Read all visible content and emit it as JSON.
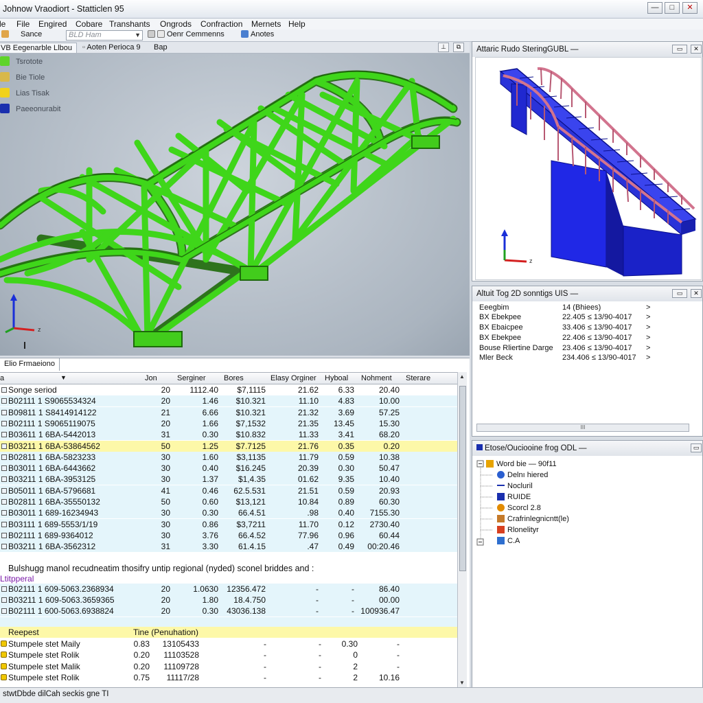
{
  "window": {
    "title": "Johnow Vraodiort - Statticlen 95"
  },
  "menu": [
    "File",
    "Engired",
    "Cobare",
    "Transhants",
    "Ongrods",
    "Confraction",
    "Mernets",
    "Help"
  ],
  "menu_prefix": "le",
  "toolbar": {
    "item1": "Sance",
    "dropdown_value": "BLD Ham",
    "item2": "Oenr Cemmenns",
    "item3": "Anotes"
  },
  "doc_tabs": [
    "VB Eegenarble Llbou",
    "Aoten Perioca 9",
    "Bap"
  ],
  "legend": [
    {
      "label": "Tsrotote",
      "color": "#5fd42a"
    },
    {
      "label": "Bie Tiole",
      "color": "#d8b84a"
    },
    {
      "label": "Lias Tisak",
      "color": "#f1d21a"
    },
    {
      "label": "Paeeonurabit",
      "color": "#1a2fae"
    }
  ],
  "panel_view": {
    "title": "Attaric Rudo SteringGUBL —"
  },
  "panel_props": {
    "title": "Altuit Tog 2D sonntigs UIS —",
    "rows": [
      {
        "key": "Eeegbim",
        "value": "14 (Bhiees)"
      },
      {
        "key": "BX Ebekpee",
        "value": "22.405 ≤ 13/90-4017"
      },
      {
        "key": "BX Ebaicpee",
        "value": "33.406 ≤ 13/90-4017"
      },
      {
        "key": "BX Ebekpee",
        "value": "22.406 ≤ 13/90-4017"
      },
      {
        "key": "Bouse Rliertine Darge",
        "value": "23.406 ≤ 13/90-4017"
      },
      {
        "key": "Mler Beck",
        "value": "234.406 ≤ 13/90-4017"
      }
    ],
    "arrow": ">",
    "hscroll": "III"
  },
  "panel_tree": {
    "title": "Etose/Ouciooine frog ODL —",
    "items": [
      {
        "label": "Word bie — 90f11",
        "indent": 0,
        "icon": "#e7a300"
      },
      {
        "label": "Delnı hiered",
        "indent": 1,
        "icon": "#2b5fd0"
      },
      {
        "label": "Nocluril",
        "indent": 1,
        "icon": "#1a2fae"
      },
      {
        "label": "RUIDE",
        "indent": 1,
        "icon": "#1a2fae"
      },
      {
        "label": "Scorcl 2.8",
        "indent": 1,
        "icon": "#e28b00"
      },
      {
        "label": "Crafrinlegnicntt(le)",
        "indent": 1,
        "icon": "#c57a2a"
      },
      {
        "label": "Rlonelityr",
        "indent": 1,
        "icon": "#d84020"
      },
      {
        "label": "C.A",
        "indent": 1,
        "icon": "#2e6fcf"
      }
    ]
  },
  "bottom": {
    "tab": "Elio Frmaeiono",
    "headers": [
      "a",
      "Jon",
      "Serginer",
      "Bores",
      "Elasy Orginer",
      "Hyboal",
      "Nohment",
      "Sterare"
    ],
    "rows": [
      {
        "cells": [
          "Songe seriod",
          "20",
          "1112.40",
          "$7,1115",
          "21.62",
          "6.33",
          "20.40"
        ],
        "bg": "white"
      },
      {
        "cells": [
          "B02111 1 S9065534324",
          "20",
          "1.46",
          "$10.321",
          "11.10",
          "4.83",
          "10.00"
        ],
        "bg": "cyan"
      },
      {
        "cells": [
          "B09811 1 S8414914122",
          "21",
          "6.66",
          "$10.321",
          "21.32",
          "3.69",
          "57.25"
        ],
        "bg": "cyan"
      },
      {
        "cells": [
          "B02111 1 S9065119075",
          "20",
          "1.66",
          "$7,1532",
          "21.35",
          "13.45",
          "15.30"
        ],
        "bg": "cyan"
      },
      {
        "cells": [
          "B03611 1 6BA-5442013",
          "31",
          "0.30",
          "$10.832",
          "11.33",
          "3.41",
          "68.20"
        ],
        "bg": "cyan"
      },
      {
        "cells": [
          "B03211 1 6BA-53864562",
          "50",
          "1.25",
          "$7.7125",
          "21.76",
          "0.35",
          "0.20"
        ],
        "bg": "yellow"
      },
      {
        "cells": [
          "B02811 1 6BA-5823233",
          "30",
          "1.60",
          "$3,1135",
          "11.79",
          "0.59",
          "10.38"
        ],
        "bg": "cyan"
      },
      {
        "cells": [
          "B03011 1 6BA-6443662",
          "30",
          "0.40",
          "$16.245",
          "20.39",
          "0.30",
          "50.47"
        ],
        "bg": "cyan"
      },
      {
        "cells": [
          "B03211 1 6BA-3953125",
          "30",
          "1.37",
          "$1,4.35",
          "01.62",
          "9.35",
          "10.40"
        ],
        "bg": "cyan"
      },
      {
        "cells": [
          "B05011 1 6BA-5796681",
          "41",
          "0.46",
          "62.5.531",
          "21.51",
          "0.59",
          "20.93"
        ],
        "bg": "cyan"
      },
      {
        "cells": [
          "B02811 1 6BA-35550132",
          "50",
          "0.60",
          "$13,121",
          "10.84",
          "0.89",
          "60.30"
        ],
        "bg": "cyan"
      },
      {
        "cells": [
          "B03011 1 689-16234943",
          "30",
          "0.30",
          "66.4.51",
          ".98",
          "0.40",
          "7155.30"
        ],
        "bg": "cyan"
      },
      {
        "cells": [
          "B03111 1 689-5553/1/19",
          "30",
          "0.86",
          "$3,7211",
          "11.70",
          "0.12",
          "2730.40"
        ],
        "bg": "cyan"
      },
      {
        "cells": [
          "B02111 1 689-9364012",
          "30",
          "3.76",
          "66.4.52",
          "77.96",
          "0.96",
          "60.44"
        ],
        "bg": "cyan"
      },
      {
        "cells": [
          "B03211 1 6BA-3562312",
          "31",
          "3.30",
          "61.4.15",
          ".47",
          "0.49",
          "00:20.46"
        ],
        "bg": "cyan"
      }
    ],
    "note": "Bulshugg manol recudneatim thosifry untip regional (nyded) sconel briddes and :",
    "subheader": "Ltitpperal",
    "rows2": [
      {
        "cells": [
          "B02111 1 609-5063.2368934",
          "20",
          "1.0630",
          "12356.472",
          "-",
          "-",
          "86.40"
        ]
      },
      {
        "cells": [
          "B03211 1 609-5063.3659365",
          "20",
          "1.80",
          "18.4.750",
          "-",
          "-",
          "00.00"
        ]
      },
      {
        "cells": [
          "B02111 1 600-5063.6938824",
          "20",
          "0.30",
          "43036.138",
          "-",
          "-",
          "100936.47"
        ]
      }
    ],
    "section2_head": [
      "Reepest",
      "Tine (Penuhation)"
    ],
    "rows3": [
      {
        "cells": [
          "Stumpele stet Maily",
          "0.83",
          "13105433",
          "-",
          "-",
          "0.30",
          "-"
        ]
      },
      {
        "cells": [
          "Stumpele stet Rolik",
          "0.20",
          "11103528",
          "-",
          "-",
          "0",
          "-"
        ]
      },
      {
        "cells": [
          "Stumpele stet Malik",
          "0.20",
          "11109728",
          "-",
          "-",
          "2",
          "-"
        ]
      },
      {
        "cells": [
          "Stumpele stet Rolik",
          "0.75",
          "11117/28",
          "-",
          "-",
          "2",
          "10.16"
        ]
      }
    ]
  },
  "statusbar": "stwtDbde dilCah seckis gne TI",
  "colors": {
    "green": "#39d40e",
    "blue": "#1c2fe0",
    "pink": "#d2748e"
  }
}
